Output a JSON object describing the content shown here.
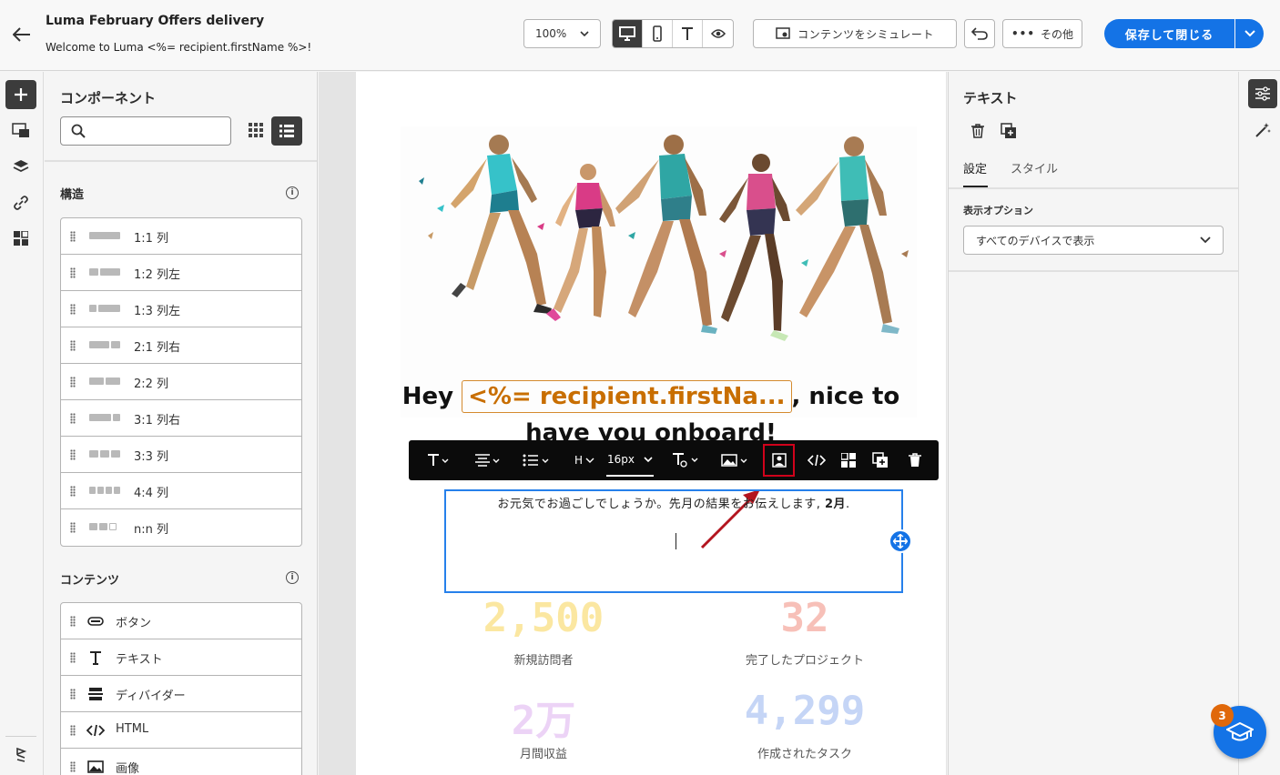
{
  "header": {
    "title": "Luma February Offers delivery",
    "subtitle": "Welcome to Luma <%= recipient.firstName %>!",
    "zoom": "100%",
    "simulate_label": "コンテンツをシミュレート",
    "more_label": "その他",
    "save_label": "保存して閉じる"
  },
  "components_panel": {
    "title": "コンポーネント",
    "search_placeholder": "",
    "structure_heading": "構造",
    "structures": [
      {
        "label": "1:1 列"
      },
      {
        "label": "1:2 列左"
      },
      {
        "label": "1:3 列左"
      },
      {
        "label": "2:1 列右"
      },
      {
        "label": "2:2 列"
      },
      {
        "label": "3:1 列右"
      },
      {
        "label": "3:3 列"
      },
      {
        "label": "4:4 列"
      },
      {
        "label": "n:n 列"
      }
    ],
    "content_heading": "コンテンツ",
    "contents": [
      {
        "label": "ボタン",
        "icon": "button-icon"
      },
      {
        "label": "テキスト",
        "icon": "text-icon"
      },
      {
        "label": "ディバイダー",
        "icon": "divider-icon"
      },
      {
        "label": "HTML",
        "icon": "html-icon"
      },
      {
        "label": "画像",
        "icon": "image-icon"
      }
    ]
  },
  "email": {
    "headline_before": "Hey ",
    "personalization": "<%= recipient.firstNa...",
    "headline_after": ", nice to",
    "headline_line2": "have you onboard!",
    "body_text_start": "お元気でお過ごしでしょうか。先月の結果をお伝えします, ",
    "body_text_bold": "2月",
    "body_text_end": ".",
    "stats": [
      {
        "value": "2,500",
        "label": "新規訪問者",
        "color": "#fbe7a1"
      },
      {
        "value": "32",
        "label": "完了したプロジェクト",
        "color": "#f7c0b8"
      },
      {
        "value": "2万",
        "label": "月間収益",
        "color": "#ecd3f6"
      },
      {
        "value": "4,299",
        "label": "作成されたタスク",
        "color": "#c5d5f6"
      }
    ]
  },
  "toolbar": {
    "font_size": "16px",
    "heading": "H"
  },
  "properties_panel": {
    "title": "テキスト",
    "tab_settings": "設定",
    "tab_style": "スタイル",
    "display_option_label": "表示オプション",
    "display_option_value": "すべてのデバイスで表示"
  },
  "help": {
    "badge_count": "3"
  },
  "colors": {
    "accent": "#1473e6",
    "personalization": "#c86e00",
    "highlight": "#d0021b"
  }
}
